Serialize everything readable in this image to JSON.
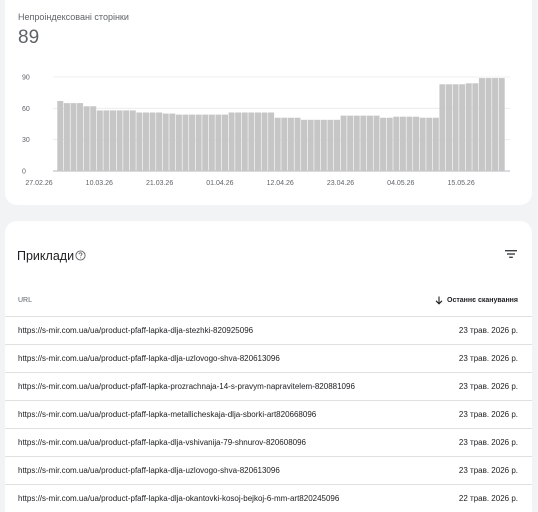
{
  "indexing_chart": {
    "metric_label": "Непроіндексовані сторінки",
    "metric_value": "89",
    "bar_color": "#c6c6c6"
  },
  "chart_data": {
    "type": "bar",
    "title": "",
    "xlabel": "",
    "ylabel": "",
    "ylim": [
      0,
      90
    ],
    "yticks": [
      "0",
      "30",
      "60",
      "90"
    ],
    "xtick_labels": [
      "27.02.26",
      "10.03.26",
      "21.03.26",
      "01.04.26",
      "12.04.26",
      "23.04.26",
      "04.05.26",
      "15.05.26"
    ],
    "grid": true,
    "values": [
      67,
      65,
      65,
      65,
      62,
      62,
      58,
      58,
      58,
      58,
      58,
      58,
      56,
      56,
      56,
      56,
      55,
      55,
      54,
      54,
      54,
      54,
      54,
      54,
      54,
      54,
      56,
      56,
      56,
      56,
      56,
      56,
      56,
      51,
      51,
      51,
      51,
      49,
      49,
      49,
      49,
      49,
      49,
      53,
      53,
      53,
      53,
      53,
      53,
      51,
      51,
      52,
      52,
      52,
      52,
      51,
      51,
      51,
      83,
      83,
      83,
      83,
      84,
      84,
      89,
      89,
      89,
      89
    ]
  },
  "examples": {
    "title": "Приклади",
    "help_icon": "help-circle-icon",
    "filter_icon": "filter-icon",
    "col_url": "URL",
    "col_date": "Останнє сканування",
    "sort_icon": "arrow-down-icon",
    "rows": [
      {
        "url": "https://s-mir.com.ua/ua/product-pfaff-lapka-dlja-stezhki-820925096",
        "date": "23 трав. 2026 р."
      },
      {
        "url": "https://s-mir.com.ua/ua/product-pfaff-lapka-dlja-uzlovogo-shva-820613096",
        "date": "23 трав. 2026 р."
      },
      {
        "url": "https://s-mir.com.ua/ua/product-pfaff-lapka-prozrachnaja-14-s-pravym-napravitelem-820881096",
        "date": "23 трав. 2026 р."
      },
      {
        "url": "https://s-mir.com.ua/ua/product-pfaff-lapka-metallicheskaja-dlja-sborki-art820668096",
        "date": "23 трав. 2026 р."
      },
      {
        "url": "https://s-mir.com.ua/ua/product-pfaff-lapka-dlja-vshivanija-79-shnurov-820608096",
        "date": "23 трав. 2026 р."
      },
      {
        "url": "https://s-mir.com.ua/ua/product-pfaff-lapka-dlja-uzlovogo-shva-820613096",
        "date": "23 трав. 2026 р."
      },
      {
        "url": "https://s-mir.com.ua/ua/product-pfaff-lapka-dlja-okantovki-kosoj-bejkoj-6-mm-art820245096",
        "date": "22 трав. 2026 р."
      }
    ]
  }
}
